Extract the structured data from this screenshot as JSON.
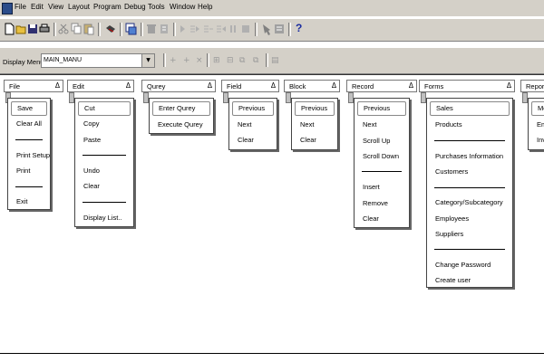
{
  "menubar": {
    "items": [
      "File",
      "Edit",
      "View",
      "Layout",
      "Program",
      "Debug",
      "Tools",
      "Window",
      "Help"
    ]
  },
  "toolbar": {
    "display_menu_label": "Display Menu:",
    "display_menu_value": "MAIN_MANU",
    "help_glyph": "?"
  },
  "menus": [
    {
      "title": "File",
      "delta": "Δ",
      "items": [
        "Save",
        "Clear All",
        "---",
        "Print Setup",
        "Print",
        "---",
        "Exit"
      ]
    },
    {
      "title": "Edit",
      "delta": "Δ",
      "items": [
        "Cut",
        "Copy",
        "Paste",
        "---",
        "Undo",
        "Clear",
        "---",
        "Display List.."
      ]
    },
    {
      "title": "Qurey",
      "delta": "Δ",
      "items": [
        "Enter Qurey",
        "Execute Qurey"
      ]
    },
    {
      "title": "Field",
      "delta": "Δ",
      "items": [
        "Previous",
        "Next",
        "Clear"
      ]
    },
    {
      "title": "Block",
      "delta": "Δ",
      "items": [
        "Previous",
        "Next",
        "Clear"
      ]
    },
    {
      "title": "Record",
      "delta": "Δ",
      "items": [
        "Previous",
        "Next",
        "Scroll Up",
        "Scroll Down",
        "---",
        "Insert",
        "Remove",
        "Clear"
      ]
    },
    {
      "title": "Forms",
      "delta": "Δ",
      "items": [
        "Sales",
        "Products",
        "---",
        "Purchases Information",
        "Customers",
        "---",
        "Category/Subcategory",
        "Employees",
        "Suppliers",
        "---",
        "Change Password",
        "Create user"
      ]
    },
    {
      "title": "Repor",
      "delta": "",
      "items": [
        "Mo",
        "Em",
        "Inv"
      ]
    }
  ]
}
